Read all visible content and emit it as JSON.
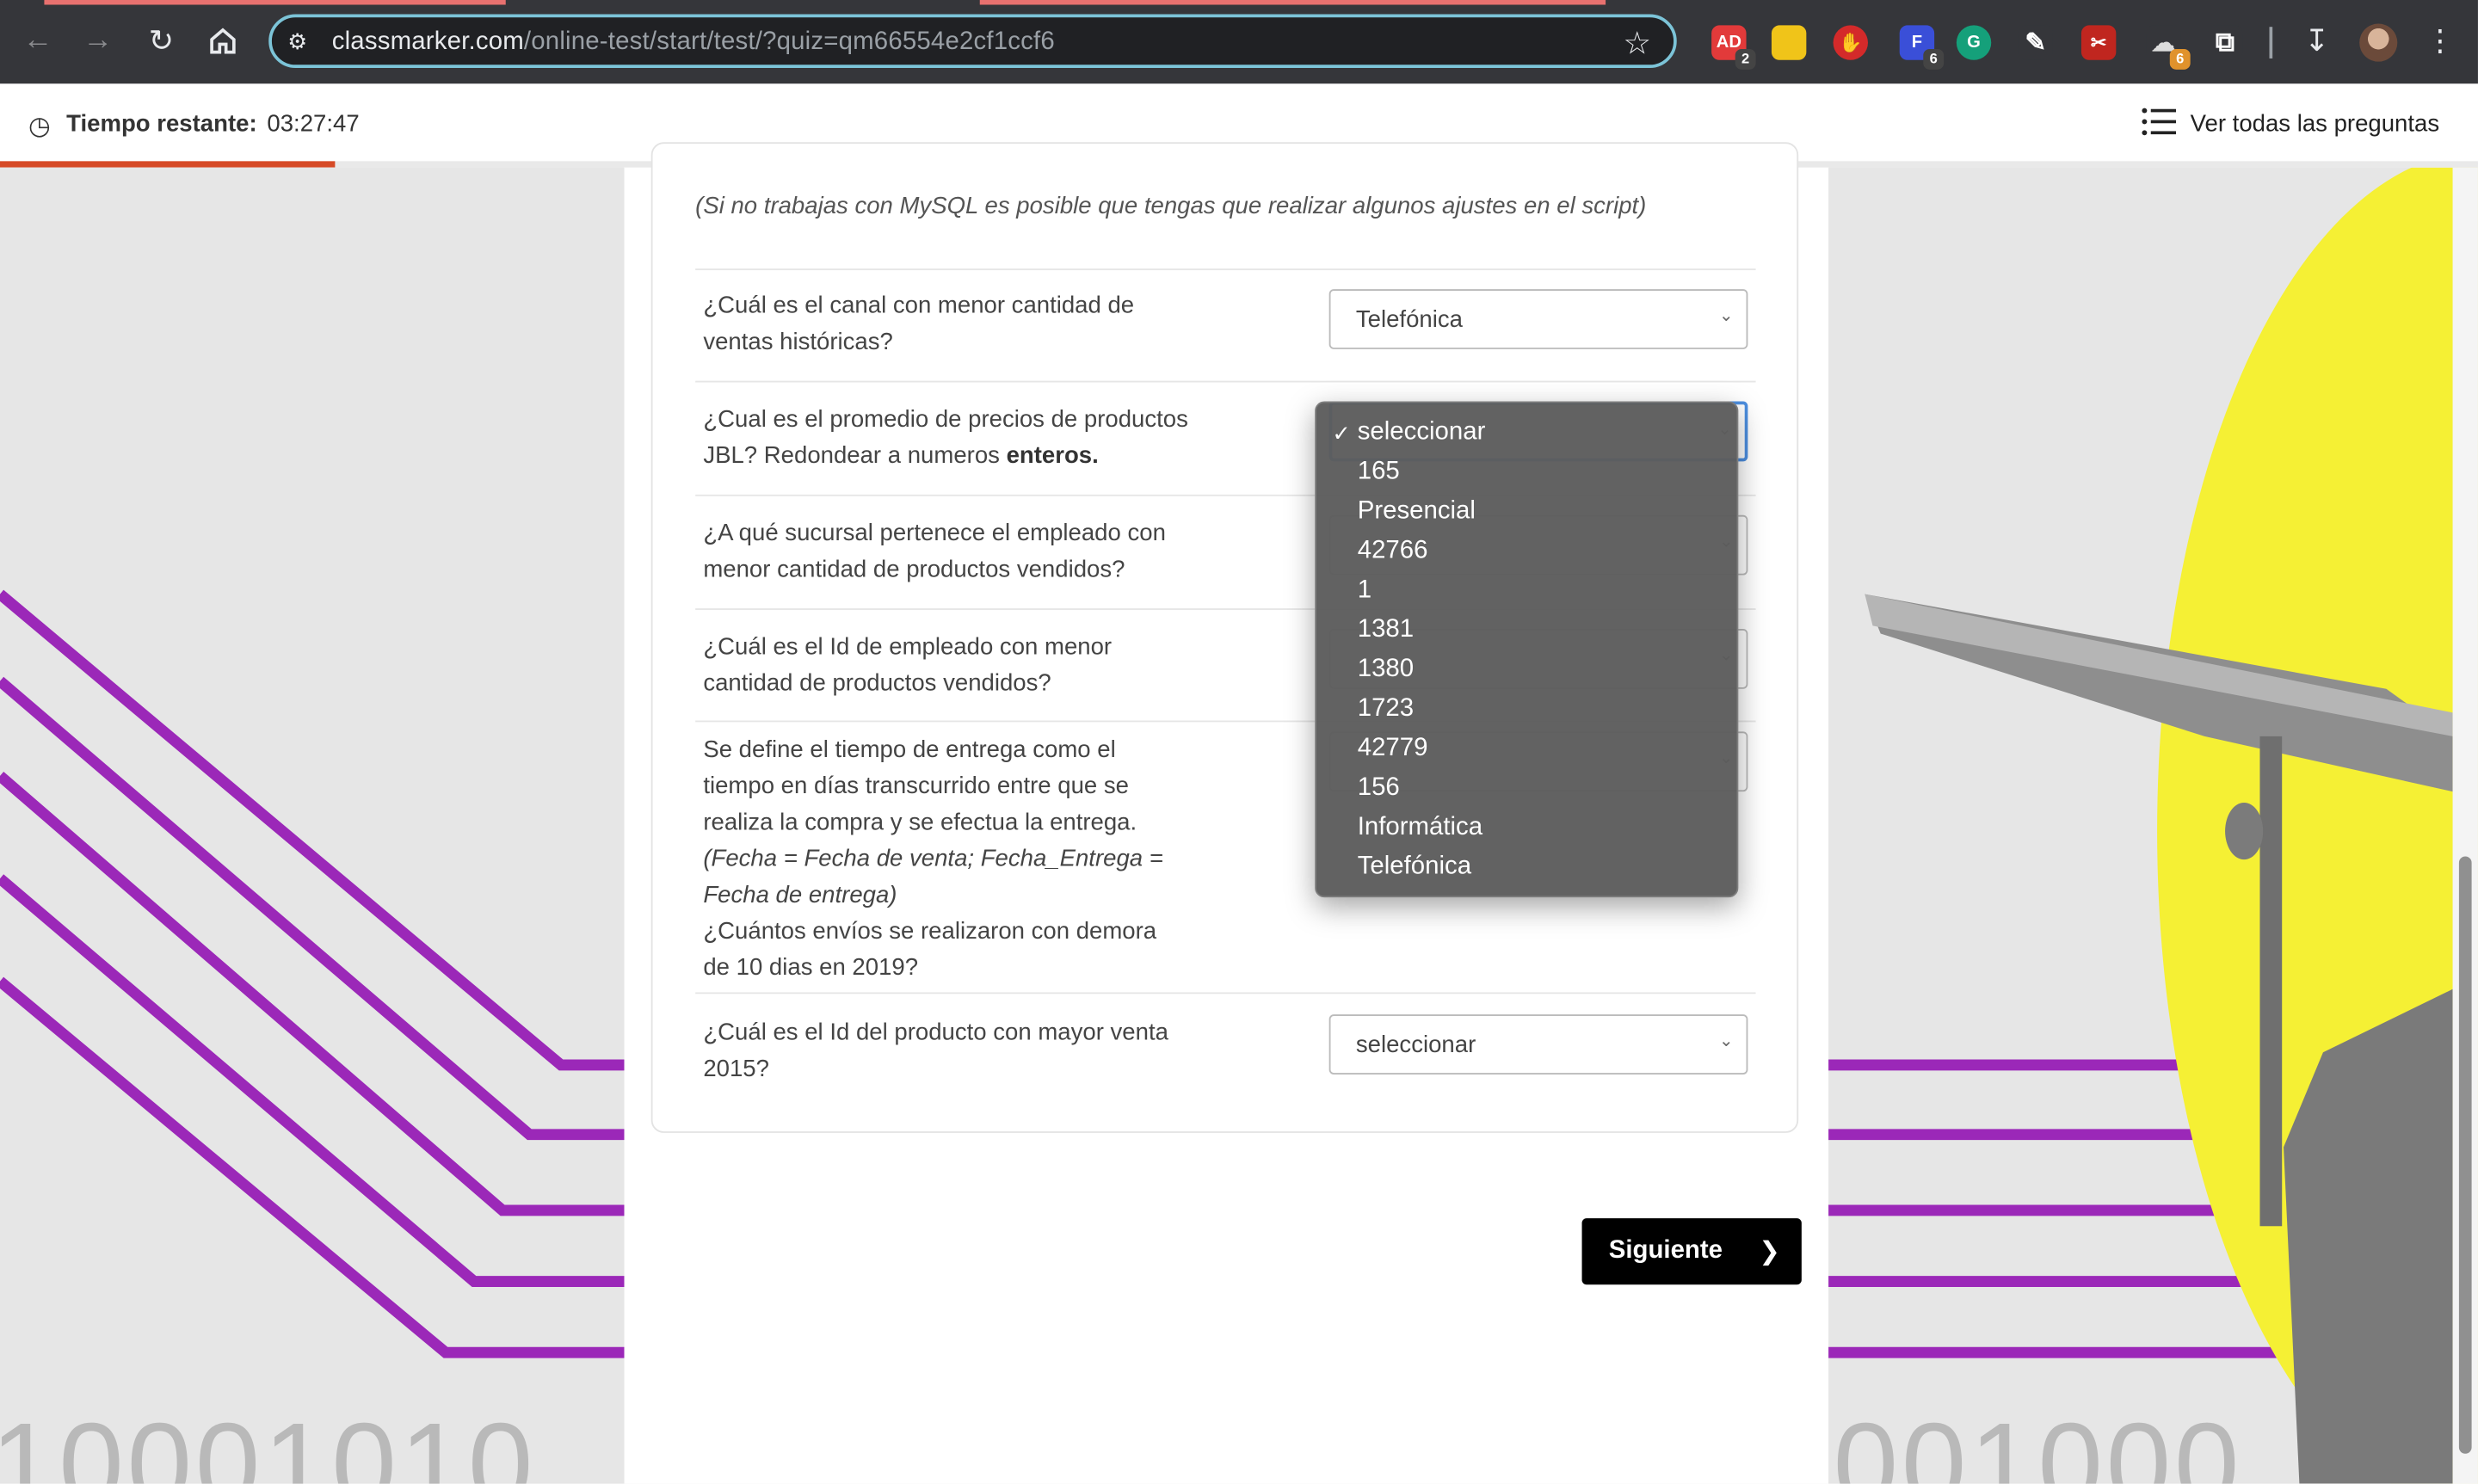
{
  "browser": {
    "url_host": "classmarker.com",
    "url_path": "/online-test/start/test/?quiz=qm66554e2cf1ccf6",
    "extensions": [
      {
        "name": "adblock-extension",
        "label": "AD",
        "badge": "2",
        "color": "#e23a3a"
      },
      {
        "name": "notes-extension",
        "label": "",
        "badge": "",
        "color": "#f0c419"
      },
      {
        "name": "hand-extension",
        "label": "",
        "badge": "",
        "color": "#d42a2a"
      },
      {
        "name": "figma-extension",
        "label": "F",
        "badge": "6",
        "color": "#3a4fd8"
      },
      {
        "name": "grammarly-extension",
        "label": "G",
        "badge": "",
        "color": "#15a07a"
      },
      {
        "name": "eyedropper-extension",
        "label": "",
        "badge": "",
        "color": "#35363a"
      },
      {
        "name": "pdf-extension",
        "label": "",
        "badge": "",
        "color": "#c0261f"
      },
      {
        "name": "bird-extension",
        "label": "",
        "badge": "6",
        "color": "#35363a"
      },
      {
        "name": "puzzle-extension",
        "label": "",
        "badge": "",
        "color": "#35363a"
      }
    ]
  },
  "quiz_header": {
    "timer_label": "Tiempo restante:",
    "timer_value": "03:27:47",
    "see_all_label": "Ver todas las preguntas",
    "progress_fraction": 0.135
  },
  "card": {
    "note": "(Si no trabajas con MySQL es posible que tengas que realizar algunos ajustes en el script)",
    "questions": [
      {
        "lines": [
          "¿Cuál es el canal con menor cantidad de",
          "ventas históricas?"
        ],
        "selected": "Telefónica"
      },
      {
        "line1": "¿Cual es el promedio de precios de productos",
        "line2_pre": "JBL? Redondear a numeros ",
        "line2_bold": "enteros.",
        "selected": "seleccionar"
      },
      {
        "lines": [
          "¿A qué sucursal pertenece el empleado con",
          "menor cantidad de productos vendidos?"
        ]
      },
      {
        "lines": [
          "¿Cuál es el Id de empleado con menor",
          "cantidad de productos vendidos?"
        ]
      },
      {
        "lines": [
          "Se define el tiempo de entrega como el",
          "tiempo en días transcurrido entre que se",
          "realiza la compra y se efectua la entrega."
        ],
        "italic_lines": [
          "(Fecha = Fecha de venta; Fecha_Entrega =",
          "Fecha de entrega)"
        ],
        "tail_lines": [
          "¿Cuántos envíos se realizaron con demora",
          "de 10 dias en 2019?"
        ]
      },
      {
        "lines": [
          "¿Cuál es el Id del producto con mayor venta",
          "2015?"
        ],
        "selected": "seleccionar"
      }
    ]
  },
  "dropdown": {
    "check_mark": "✓",
    "options": [
      "seleccionar",
      "165",
      "Presencial",
      "42766",
      "1",
      "1381",
      "1380",
      "1723",
      "42779",
      "156",
      "Informática",
      "Telefónica"
    ],
    "selected_index": 0
  },
  "next_button": {
    "label": "Siguiente"
  },
  "background": {
    "left_bits": "10001010",
    "right_bits": "001000",
    "accent": "#9b28b8",
    "yellow": "#f5f034"
  }
}
